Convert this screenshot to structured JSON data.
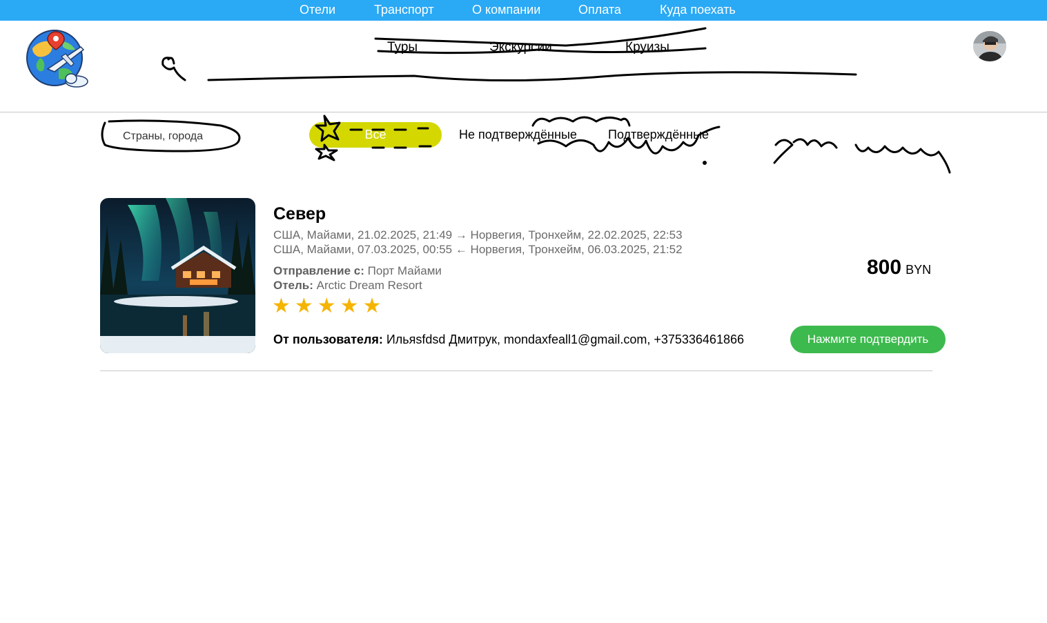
{
  "top_nav": [
    "Отели",
    "Транспорт",
    "О компании",
    "Оплата",
    "Куда поехать"
  ],
  "main_nav": [
    "Туры",
    "Экскурсии",
    "Круизы"
  ],
  "search": {
    "placeholder": "Страны, города"
  },
  "filters": {
    "all": "Все",
    "unconfirmed": "Не подтверждённые",
    "confirmed": "Подтверждённые"
  },
  "card": {
    "title": "Север",
    "route_out": "США, Майами, 21.02.2025, 21:49 → Норвегия, Тронхейм, 22.02.2025, 22:53",
    "route_back": "США, Майами, 07.03.2025, 00:55 ← Норвегия, Тронхейм, 06.03.2025, 21:52",
    "departure_label": "Отправление с:",
    "departure_value": "Порт Майами",
    "hotel_label": "Отель:",
    "hotel_value": "Arctic Dream Resort",
    "rating": 5,
    "stars_text": "★★★★★",
    "user_label": "От пользователя:",
    "user_value": "Ильяsfdsd Дмитрук, mondaxfeall1@gmail.com, +375336461866",
    "price": "800",
    "currency": "BYN",
    "confirm_label": "Нажмите подтвердить"
  },
  "colors": {
    "top_bar": "#2aa9f5",
    "active_filter": "#d4d800",
    "confirm": "#3dba4e",
    "stars": "#f5b400"
  },
  "icons": [
    "globe-plane-logo-icon",
    "user-avatar-icon",
    "star-icon"
  ]
}
